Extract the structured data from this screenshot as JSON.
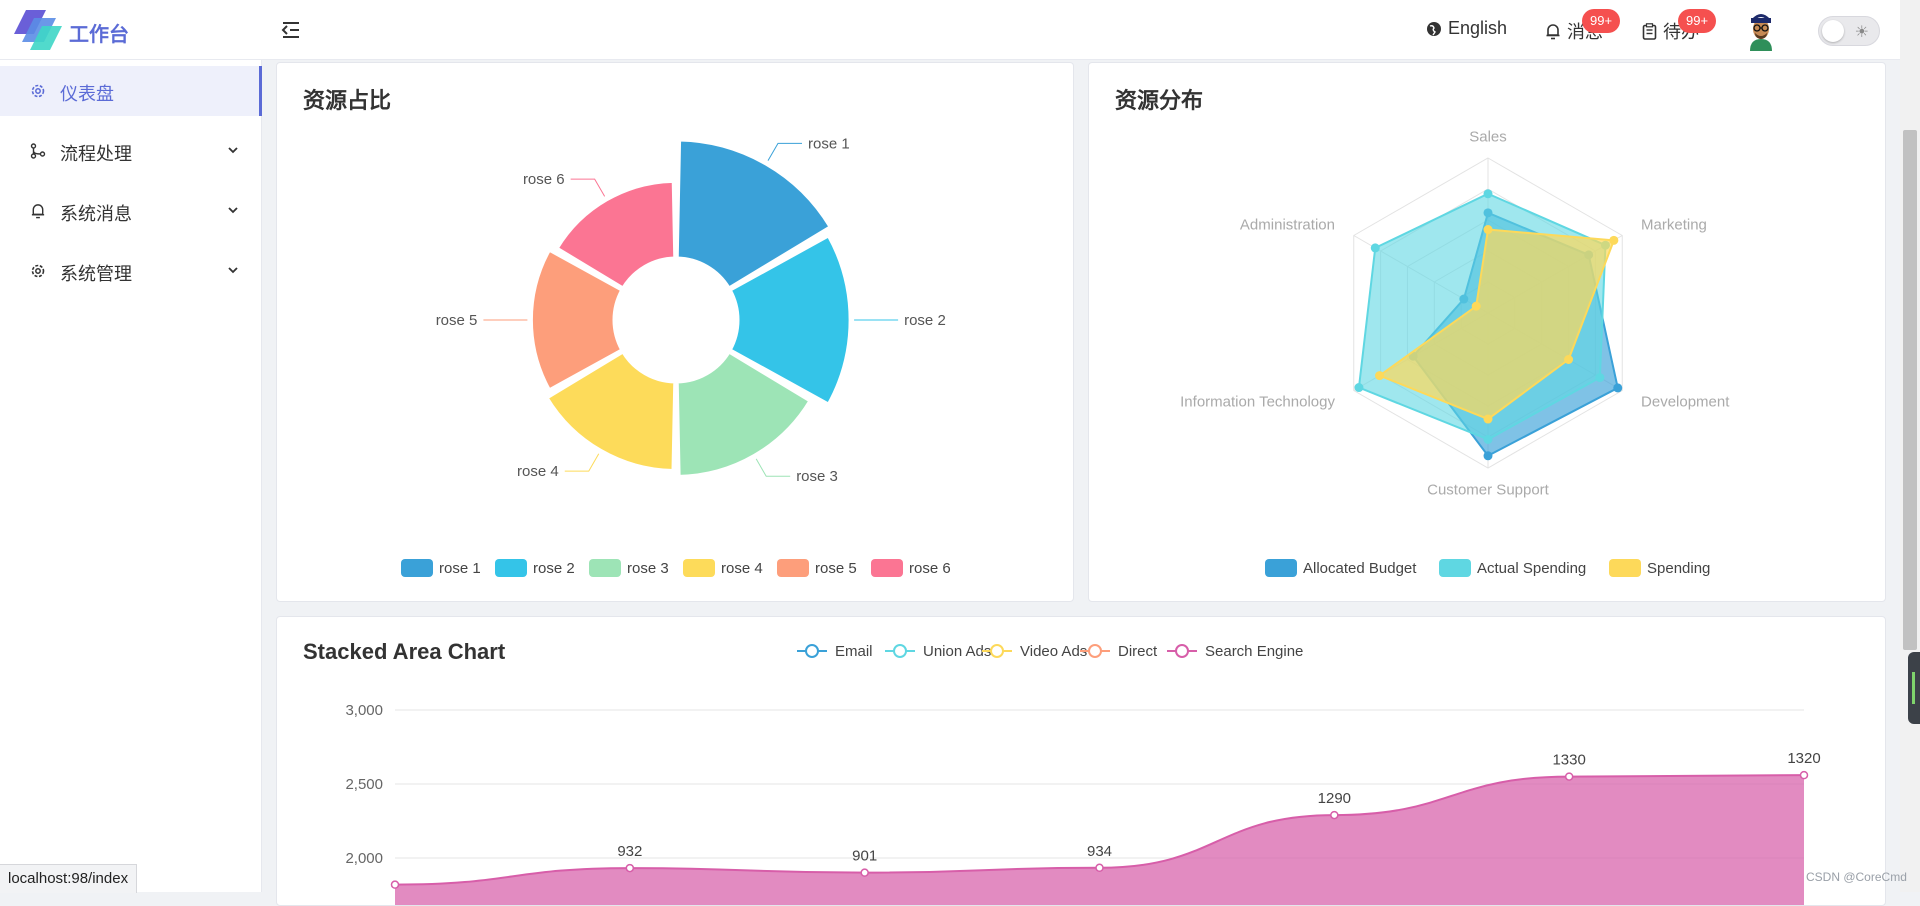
{
  "header": {
    "logo_text": "工作台",
    "language": "English",
    "messages_label": "消息",
    "messages_badge": "99+",
    "todo_label": "待办",
    "todo_badge": "99+"
  },
  "sidebar": {
    "items": [
      {
        "label": "仪表盘",
        "icon": "gear-icon",
        "active": true
      },
      {
        "label": "流程处理",
        "icon": "flow-icon",
        "active": false
      },
      {
        "label": "系统消息",
        "icon": "bell-icon",
        "active": false
      },
      {
        "label": "系统管理",
        "icon": "gear-icon",
        "active": false
      }
    ]
  },
  "cards": {
    "pie_title": "资源占比",
    "radar_title": "资源分布",
    "area_title": "Stacked Area Chart"
  },
  "status_url": "localhost:98/index",
  "watermark": "CSDN @CoreCmd",
  "colors": {
    "accent": "#5b6bd6",
    "badge": "#f5504f",
    "pie": [
      "#3aa1d8",
      "#34c4e8",
      "#9de4b6",
      "#fddb5a",
      "#fd9e7b",
      "#fb7593"
    ],
    "radar": [
      "#3aa1d8",
      "#5fd7e2",
      "#fdd95a"
    ],
    "area": [
      "#3aa1d8",
      "#5fd7e2",
      "#fdd95a",
      "#fd9e7b",
      "#d75ea9"
    ]
  },
  "chart_data": [
    {
      "type": "pie",
      "variant": "rose",
      "labels": [
        "rose 1",
        "rose 2",
        "rose 3",
        "rose 4",
        "rose 5",
        "rose 6"
      ],
      "values": [
        40,
        38,
        32,
        30,
        28,
        26
      ],
      "legend": [
        "rose 1",
        "rose 2",
        "rose 3",
        "rose 4",
        "rose 5",
        "rose 6"
      ],
      "legend_position": "bottom"
    },
    {
      "type": "radar",
      "indicators": [
        {
          "name": "Sales",
          "max": 6500
        },
        {
          "name": "Marketing",
          "max": 16000
        },
        {
          "name": "Development",
          "max": 30000
        },
        {
          "name": "Customer Support",
          "max": 38000
        },
        {
          "name": "Information Technology",
          "max": 52000
        },
        {
          "name": "Administration",
          "max": 25000
        }
      ],
      "series": [
        {
          "name": "Allocated Budget",
          "values": [
            4200,
            12000,
            29000,
            35000,
            29000,
            4500
          ]
        },
        {
          "name": "Actual Spending",
          "values": [
            5000,
            14000,
            25000,
            31000,
            50000,
            21000
          ]
        },
        {
          "name": "Spending",
          "values": [
            3500,
            15000,
            18000,
            26000,
            42000,
            2200
          ]
        }
      ],
      "legend_position": "bottom"
    },
    {
      "type": "area",
      "stacked": true,
      "smooth": true,
      "legend": [
        "Email",
        "Union Ads",
        "Video Ads",
        "Direct",
        "Search Engine"
      ],
      "legend_position": "top",
      "yticks": [
        "3,000",
        "2,500",
        "2,000"
      ],
      "ylim": [
        0,
        3000
      ],
      "series": [
        {
          "name": "Search Engine",
          "top_values": [
            1820,
            1932,
            1901,
            1934,
            2290,
            2550,
            2560
          ]
        }
      ],
      "data_labels": [
        {
          "index": 1,
          "label": "932"
        },
        {
          "index": 2,
          "label": "901"
        },
        {
          "index": 3,
          "label": "934"
        },
        {
          "index": 4,
          "label": "1290"
        },
        {
          "index": 5,
          "label": "1330"
        },
        {
          "index": 6,
          "label": "1320"
        }
      ]
    }
  ]
}
